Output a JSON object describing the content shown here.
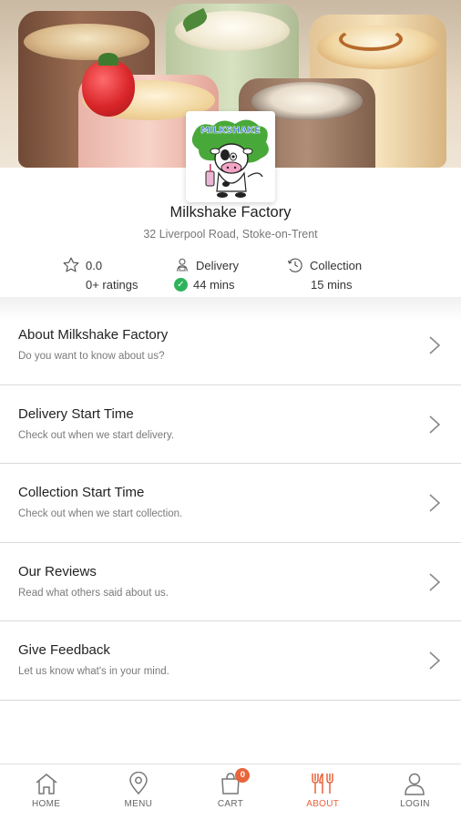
{
  "restaurant": {
    "name": "Milkshake Factory",
    "address": "32 Liverpool Road, Stoke-on-Trent",
    "logo_text": "MILKSHAKE"
  },
  "stats": {
    "rating": "0.0",
    "ratings_count": "0+ ratings",
    "delivery_label": "Delivery",
    "delivery_time": "44 mins",
    "collection_label": "Collection",
    "collection_time": "15 mins"
  },
  "menu": [
    {
      "title": "About Milkshake Factory",
      "subtitle": "Do you want to know about us?"
    },
    {
      "title": "Delivery Start Time",
      "subtitle": "Check out when we start delivery."
    },
    {
      "title": "Collection Start Time",
      "subtitle": "Check out when we start collection."
    },
    {
      "title": "Our Reviews",
      "subtitle": "Read what others said about us."
    },
    {
      "title": "Give Feedback",
      "subtitle": "Let us know what's in your mind."
    }
  ],
  "nav": {
    "home": "HOME",
    "menu": "MENU",
    "cart": "CART",
    "cart_count": "0",
    "about": "ABOUT",
    "login": "LOGIN",
    "active": "about"
  },
  "colors": {
    "accent": "#e8643a",
    "success": "#2fb35a"
  },
  "icons": [
    "star-icon",
    "delivery-icon",
    "check-icon",
    "clock-icon",
    "chevron-right-icon",
    "home-icon",
    "location-pin-icon",
    "cart-icon",
    "cutlery-icon",
    "user-icon"
  ]
}
